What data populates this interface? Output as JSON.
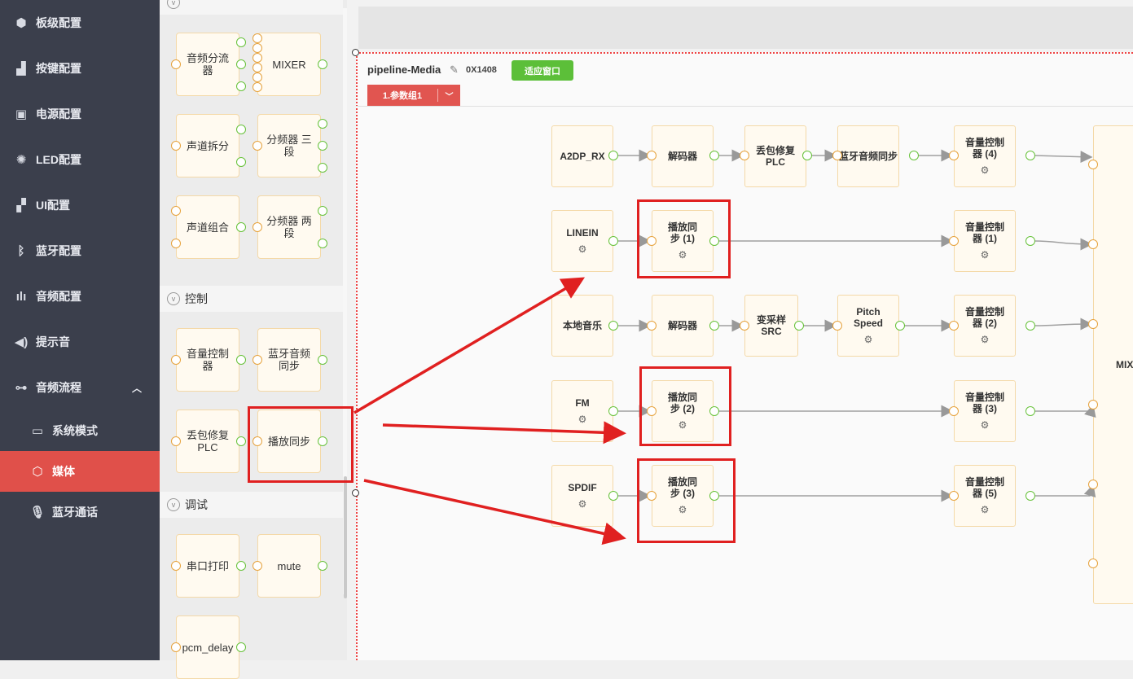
{
  "sidebar": {
    "items": [
      {
        "label": "板级配置",
        "icon": "cube-icon"
      },
      {
        "label": "按键配置",
        "icon": "keyboard-icon"
      },
      {
        "label": "电源配置",
        "icon": "battery-icon"
      },
      {
        "label": "LED配置",
        "icon": "bulb-icon"
      },
      {
        "label": "UI配置",
        "icon": "grid-icon"
      },
      {
        "label": "蓝牙配置",
        "icon": "bluetooth-icon"
      },
      {
        "label": "音频配置",
        "icon": "waveform-icon"
      },
      {
        "label": "提示音",
        "icon": "speaker-icon"
      },
      {
        "label": "音频流程",
        "icon": "flow-icon"
      }
    ],
    "sub_items": [
      {
        "label": "系统模式",
        "icon": "monitor-icon"
      },
      {
        "label": "媒体",
        "icon": "box-icon"
      },
      {
        "label": "蓝牙通话",
        "icon": "microphone-icon"
      }
    ]
  },
  "palette": {
    "sections": [
      {
        "label": "控制"
      },
      {
        "label": "调试"
      }
    ],
    "blocks": [
      "音频分流器",
      "MIXER",
      "声道拆分",
      "分频器 三段",
      "声道组合",
      "分频器 两段",
      "音量控制器",
      "蓝牙音频同步",
      "丢包修复PLC",
      "播放同步",
      "串口打印",
      "mute",
      "pcm_delay"
    ]
  },
  "canvas": {
    "title": "pipeline-Media",
    "id": "0X1408",
    "fit_label": "适应窗口",
    "param_tab": "1.参数组1",
    "mixer_label": "MIX",
    "nodes": {
      "a2dp": "A2DP_RX",
      "dec1": "解码器",
      "plc": "丢包修复PLC",
      "btsync": "蓝牙音频同步",
      "vol4": "音量控制器 (4)",
      "linein": "LINEIN",
      "sync1": "播放同步 (1)",
      "vol1": "音量控制器 (1)",
      "local": "本地音乐",
      "dec2": "解码器",
      "src": "变采样 SRC",
      "pitch": "Pitch Speed",
      "vol2": "音量控制器 (2)",
      "fm": "FM",
      "sync2": "播放同步 (2)",
      "vol3": "音量控制器 (3)",
      "spdif": "SPDIF",
      "sync3": "播放同步 (3)",
      "vol5": "音量控制器 (5)"
    }
  },
  "colors": {
    "sidebar_bg": "#3b3f4c",
    "active": "#e0504a",
    "accent_green": "#5cbf39",
    "input_port": "#e6a23c",
    "output_port": "#67c23a",
    "highlight": "#e02020"
  }
}
